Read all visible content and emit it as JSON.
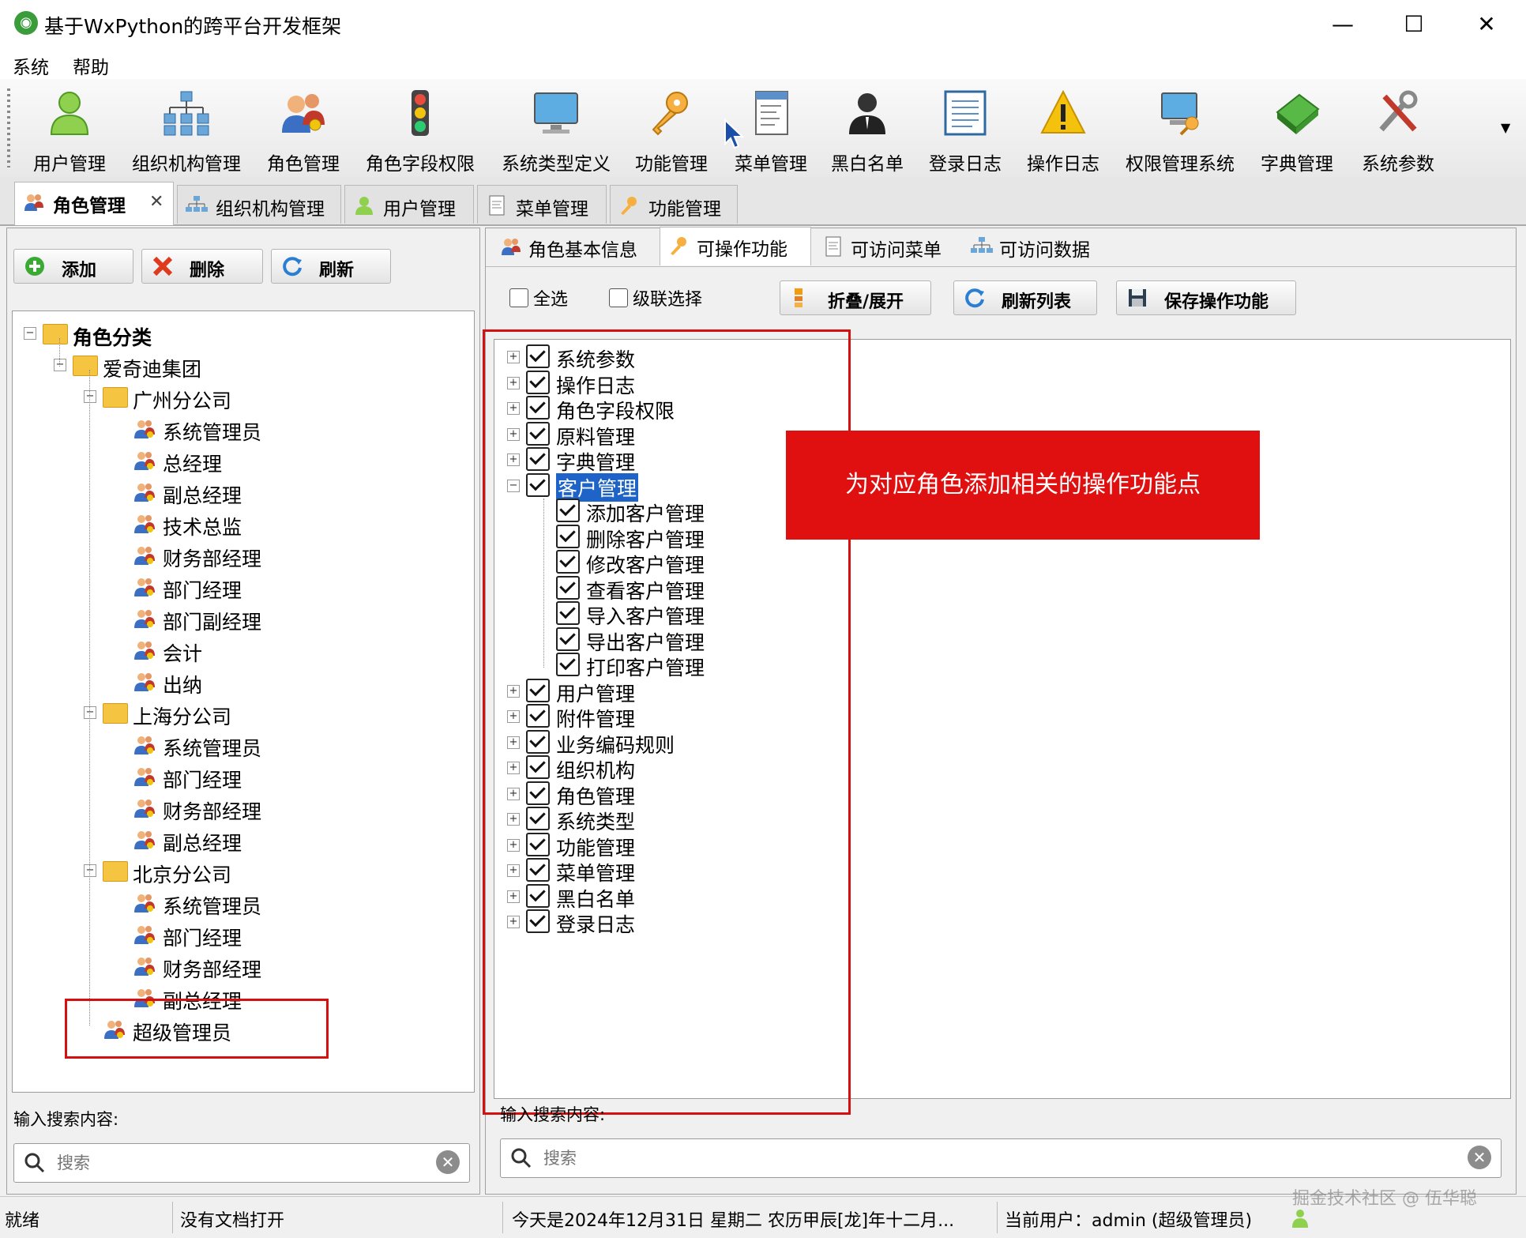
{
  "window": {
    "title": "基于WxPython的跨平台开发框架",
    "minimize": "—",
    "maximize": "☐",
    "close": "✕"
  },
  "menu": [
    "系统",
    "帮助"
  ],
  "toolbar": [
    {
      "label": "用户管理",
      "icon": "user-icon"
    },
    {
      "label": "组织机构管理",
      "icon": "org-chart-icon"
    },
    {
      "label": "角色管理",
      "icon": "role-icon"
    },
    {
      "label": "角色字段权限",
      "icon": "traffic-light-icon"
    },
    {
      "label": "系统类型定义",
      "icon": "monitor-icon"
    },
    {
      "label": "功能管理",
      "icon": "keys-icon"
    },
    {
      "label": "菜单管理",
      "icon": "menu-doc-icon"
    },
    {
      "label": "黑白名单",
      "icon": "person-dark-icon"
    },
    {
      "label": "登录日志",
      "icon": "log-doc-icon"
    },
    {
      "label": "操作日志",
      "icon": "warning-icon"
    },
    {
      "label": "权限管理系统",
      "icon": "computer-key-icon"
    },
    {
      "label": "字典管理",
      "icon": "book-icon"
    },
    {
      "label": "系统参数",
      "icon": "tools-icon"
    }
  ],
  "doc_tabs": [
    {
      "label": "角色管理",
      "active": true,
      "close": "✕"
    },
    {
      "label": "组织机构管理"
    },
    {
      "label": "用户管理"
    },
    {
      "label": "菜单管理"
    },
    {
      "label": "功能管理"
    }
  ],
  "left": {
    "buttons": {
      "add": "添加",
      "delete": "删除",
      "refresh": "刷新"
    },
    "tree": {
      "root": "角色分类",
      "group": "爱奇迪集团",
      "branches": [
        {
          "name": "广州分公司",
          "roles": [
            "系统管理员",
            "总经理",
            "副总经理",
            "技术总监",
            "财务部经理",
            "部门经理",
            "部门副经理",
            "会计",
            "出纳"
          ]
        },
        {
          "name": "上海分公司",
          "roles": [
            "系统管理员",
            "部门经理",
            "财务部经理",
            "副总经理"
          ]
        },
        {
          "name": "北京分公司",
          "roles": [
            "系统管理员",
            "部门经理",
            "财务部经理",
            "副总经理"
          ]
        }
      ],
      "extra": "超级管理员"
    },
    "search_label": "输入搜索内容:",
    "search_placeholder": "搜索"
  },
  "right": {
    "tabs": [
      {
        "label": "角色基本信息"
      },
      {
        "label": "可操作功能",
        "active": true
      },
      {
        "label": "可访问菜单"
      },
      {
        "label": "可访问数据"
      }
    ],
    "options": {
      "select_all": "全选",
      "cascade": "级联选择"
    },
    "buttons": {
      "collapse": "折叠/展开",
      "refresh": "刷新列表",
      "save": "保存操作功能"
    },
    "functions_before": [
      "系统参数",
      "操作日志",
      "角色字段权限",
      "原料管理",
      "字典管理"
    ],
    "selected": "客户管理",
    "children": [
      "添加客户管理",
      "删除客户管理",
      "修改客户管理",
      "查看客户管理",
      "导入客户管理",
      "导出客户管理",
      "打印客户管理"
    ],
    "functions_after": [
      "用户管理",
      "附件管理",
      "业务编码规则",
      "组织机构",
      "角色管理",
      "系统类型",
      "功能管理",
      "菜单管理",
      "黑白名单",
      "登录日志"
    ],
    "callout": "为对应角色添加相关的操作功能点",
    "search_label": "输入搜索内容:",
    "search_placeholder": "搜索"
  },
  "status": {
    "ready": "就绪",
    "doc": "没有文档打开",
    "date": "今天是2024年12月31日 星期二 农历甲辰[龙]年十二月...",
    "user": "当前用户：admin (超级管理员)",
    "watermark": "掘金技术社区 @ 伍华聪"
  },
  "colors": {
    "highlight": "#cc0000",
    "callout_bg": "#e01010",
    "selection": "#1e64c8",
    "accent": "#3a9c3a"
  }
}
